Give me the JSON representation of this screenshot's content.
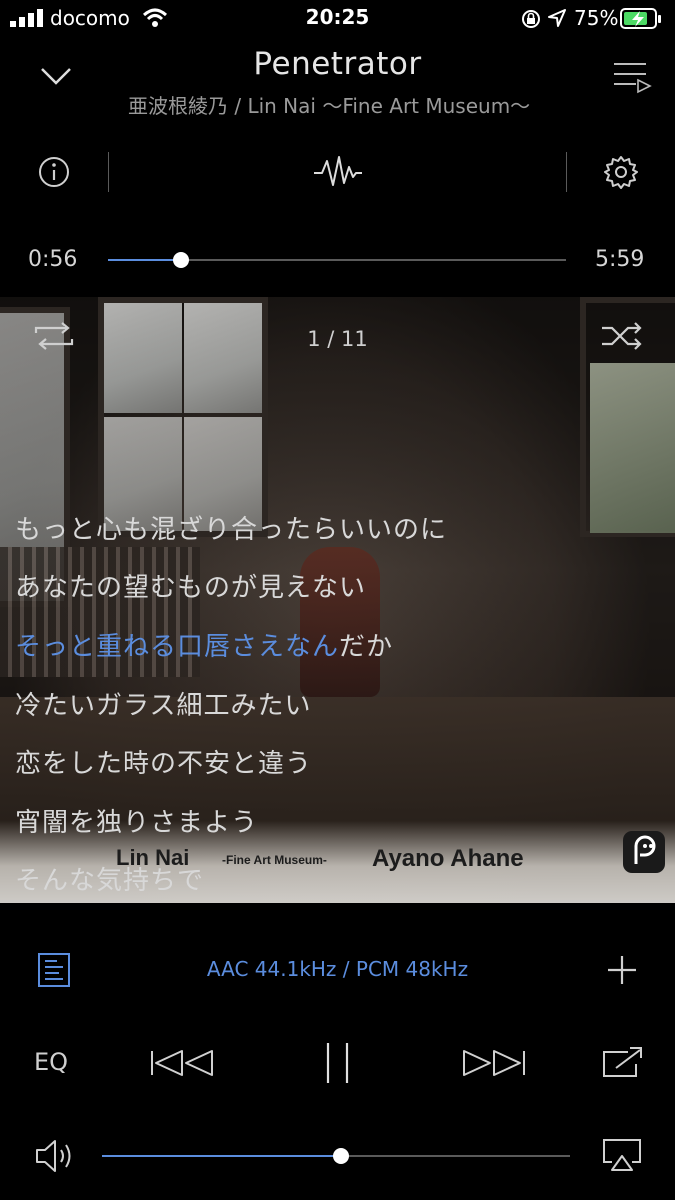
{
  "status": {
    "carrier": "docomo",
    "time": "20:25",
    "battery": "75%"
  },
  "header": {
    "title": "Penetrator",
    "subtitle": "亜波根綾乃 / Lin Nai 〜Fine Art Museum〜"
  },
  "progress": {
    "elapsed": "0:56",
    "total": "5:59",
    "fraction": 0.16
  },
  "playlist": {
    "counter": "1 / 11"
  },
  "album_text": {
    "left": "Lin Nai",
    "small": "-Fine Art Museum-",
    "right": "Ayano Ahane"
  },
  "lyrics": {
    "lines": [
      "もっと心も混ざり合ったらいいのに",
      "あなたの望むものが見えない",
      "冷たいガラス細工みたい",
      "恋をした時の不安と違う",
      "宵闇を独りさまよう",
      "そんな気持ちで"
    ],
    "active_sung": "そっと重ねる口唇さえなん",
    "active_rest": "だか"
  },
  "codec": "AAC 44.1kHz / PCM 48kHz",
  "controls": {
    "eq_label": "EQ"
  },
  "volume": {
    "fraction": 0.51
  },
  "colors": {
    "accent": "#5b8dde",
    "battery": "#4cd964"
  },
  "icons": [
    "signal-icon",
    "wifi-icon",
    "orientation-lock-icon",
    "location-icon",
    "battery-icon",
    "chevron-down-icon",
    "queue-icon",
    "info-icon",
    "waveform-icon",
    "gear-icon",
    "repeat-icon",
    "shuffle-icon",
    "app-badge-icon",
    "lyrics-icon",
    "plus-icon",
    "previous-icon",
    "pause-icon",
    "next-icon",
    "share-icon",
    "speaker-icon",
    "airplay-icon"
  ]
}
